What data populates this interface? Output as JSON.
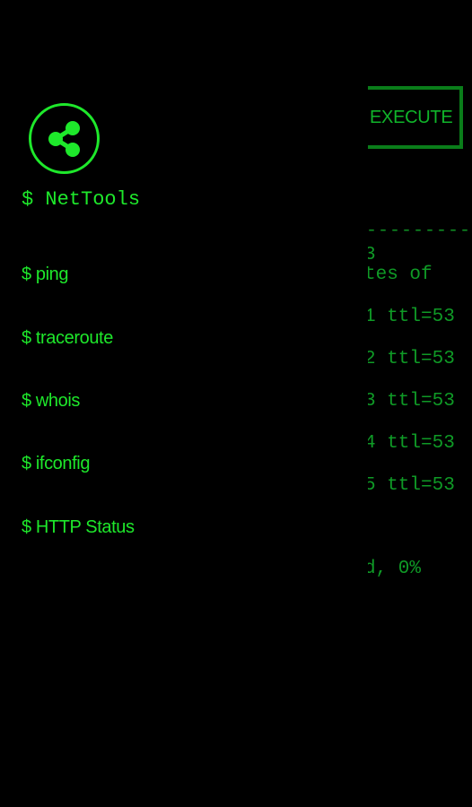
{
  "drawer": {
    "app_title": "$ NetTools",
    "menu": [
      {
        "label": "$ ping"
      },
      {
        "label": "$ traceroute"
      },
      {
        "label": "$ whois"
      },
      {
        "label": "$ ifconfig"
      },
      {
        "label": "$ HTTP Status"
      }
    ]
  },
  "background": {
    "execute_label": "EXECUTE",
    "separator": "----------",
    "output_lines": [
      "3",
      "tes of",
      "1 ttl=53",
      "2 ttl=53",
      "3 ttl=53",
      "4 ttl=53",
      "5 ttl=53",
      "d, 0%"
    ]
  },
  "colors": {
    "accent": "#1ee82b",
    "dim_green": "#0f9a26",
    "background": "#000000"
  },
  "icons": {
    "logo": "share-icon"
  }
}
